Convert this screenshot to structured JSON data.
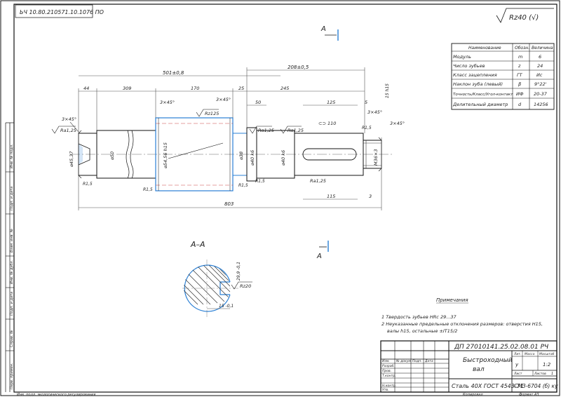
{
  "stamp_top": "ЬЧ 10.80.210571.10.1076 ПО",
  "roughness": "Rz40 (√)",
  "section_marker": "А",
  "section_label": "А–А",
  "param_table": {
    "headers": [
      "Наименование",
      "Обозн.",
      "Величина"
    ],
    "rows": [
      [
        "Модуль",
        "m",
        "6"
      ],
      [
        "Число зубьев",
        "z",
        "24"
      ],
      [
        "Класс зацепления",
        "ГТ",
        "Ис"
      ],
      [
        "Наклон зуба (левый)",
        "β",
        "9°22'"
      ],
      [
        "Точность/Класс/Угол-контакт",
        "ИФ",
        "20-37"
      ],
      [
        "Делительный диаметр",
        "d",
        "14256"
      ]
    ]
  },
  "dims": {
    "d501": "501±0,8",
    "d208": "208±0,5",
    "d44": "44",
    "d309": "309",
    "d170": "170",
    "d25": "25",
    "d50": "50",
    "d245": "245",
    "d125": "125",
    "d5": "5",
    "d115": "115",
    "d803": "803",
    "d3": "3",
    "c45a": "3×45°",
    "c45b": "3×45°",
    "c45c": "3×45°",
    "c45d": "3×45°",
    "ra125a": "Ra1,25",
    "ra125b": "Rz125",
    "ra125c": "Ra1,25",
    "ra125d": "Ra1,25",
    "ra125e": "Ra1,25",
    "d50dia": "⌀50",
    "d45dia": "⌀45,37",
    "d5456": "⌀54,56 h15",
    "d38": "⌀38",
    "d40k6a": "⌀40 k6",
    "d40k6b": "⌀40 k6",
    "m36": "М36×3",
    "r15a": "R1,5",
    "r15b": "R1,5",
    "r15c": "R1,5",
    "r15d": "R1,5",
    "r15e": "R1,5",
    "rz110": "⊂⊃ 110",
    "h15": "15 h15",
    "sec_h": "29,9 -0,1",
    "sec_w": "15 -0,1",
    "sec_ra": "Rz20"
  },
  "notes_title": "Примечания",
  "notes": [
    "1 Твердость зубьев HRc 29...37",
    "2 Неуказанные предельные отклонения размеров: отверстия H15,",
    "валы h15, остальные ±IT15/2"
  ],
  "title_block": {
    "doc_code": "ДП 27010141.25.02.08.01 РЧ",
    "name_line1": "Быстроходный",
    "name_line2": "вал",
    "material": "Сталь 40Х ГОСТ 4543-71",
    "org": "СМЗ-6704 (б) ку",
    "col_lit": "Лит.",
    "col_mass": "Масса",
    "col_scale": "Масштаб",
    "lit_val": "у",
    "scale_val": "1:2",
    "sheet_label": "Лист",
    "sheets_label": "Листов",
    "sheets_val": "1",
    "rows_left": [
      "Изм.",
      "Лист",
      "№ докум.",
      "Подп.",
      "Дата"
    ],
    "roles": [
      "Разраб.",
      "Пров.",
      "Т.контр.",
      "",
      "Н.контр.",
      "Утв."
    ]
  },
  "side_labels": [
    "Инв. № подл.",
    "Подп. и дата",
    "Взам. инв. №",
    "Инв. № дубл.",
    "Подп. и дата",
    "Справ. №",
    "Перв. примен."
  ],
  "bottom_left": "Инв. подл. экологического регулирования",
  "bottom_right_1": "Копировал",
  "bottom_right_2": "Формат А3"
}
